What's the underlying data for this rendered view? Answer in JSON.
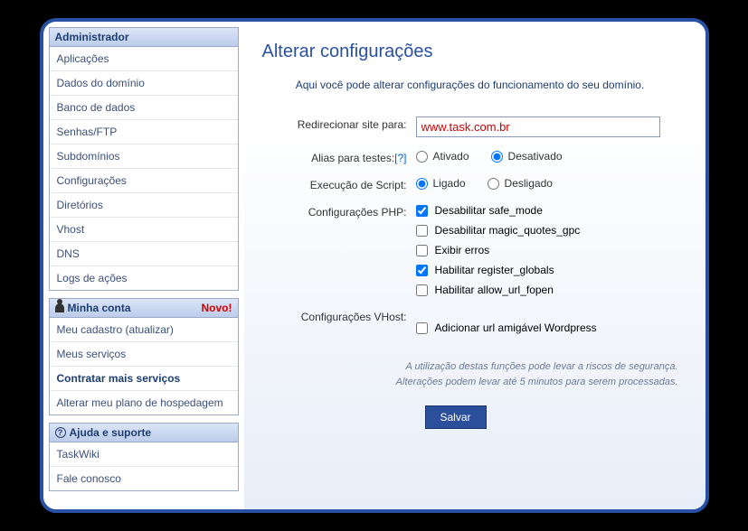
{
  "sidebar": {
    "admin": {
      "header": "Administrador",
      "items": [
        "Aplicações",
        "Dados do domínio",
        "Banco de dados",
        "Senhas/FTP",
        "Subdomínios",
        "Configurações",
        "Diretórios",
        "Vhost",
        "DNS",
        "Logs de ações"
      ]
    },
    "account": {
      "header": "Minha conta",
      "badge": "Novo!",
      "items": [
        "Meu cadastro (atualizar)",
        "Meus serviços",
        "Contratar mais serviços",
        "Alterar meu plano de hospedagem"
      ]
    },
    "help": {
      "header": "Ajuda e suporte",
      "items": [
        "TaskWiki",
        "Fale conosco"
      ]
    }
  },
  "main": {
    "title": "Alterar configurações",
    "subtitle": "Aqui você pode alterar configurações do funcionamento do seu domínio.",
    "labels": {
      "redirect": "Redirecionar site para:",
      "alias": "Alias para testes:",
      "alias_help": "[?]",
      "script": "Execução de Script:",
      "php": "Configurações PHP:",
      "vhost": "Configurações VHost:"
    },
    "redirect_value": "www.task.com.br",
    "radio": {
      "ativado": "Ativado",
      "desativado": "Desativado",
      "ligado": "Ligado",
      "desligado": "Desligado"
    },
    "php_opts": [
      "Desabilitar safe_mode",
      "Desabilitar magic_quotes_gpc",
      "Exibir erros",
      "Habilitar register_globals",
      "Habilitar allow_url_fopen"
    ],
    "vhost_opts": [
      "Adicionar url amigável Wordpress"
    ],
    "warning_l1": "A utilização destas funções pode levar a riscos de segurança.",
    "warning_l2": "Alterações podem levar até 5 minutos para serem processadas.",
    "save": "Salvar"
  }
}
